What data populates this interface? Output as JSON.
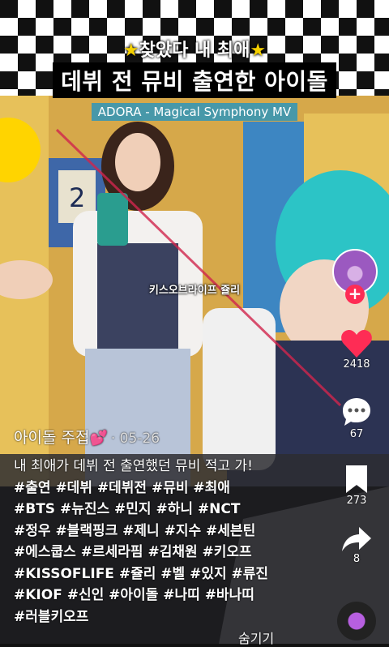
{
  "video": {
    "caption_line1": "찾았다 내 최애",
    "caption_star": "★",
    "caption_line2": "데뷔 전 뮤비 출연한 아이돌",
    "mv_label": "ADORA - Magical Symphony MV",
    "name_tag": "키스오브라이프 쥴리"
  },
  "rail": {
    "likes": "2418",
    "comments": "67",
    "bookmarks": "273",
    "shares": "8",
    "follow_symbol": "+"
  },
  "post": {
    "author": "아이돌 주접",
    "author_emoji": "💕",
    "date": "· 05-26",
    "description": "내 최애가 데뷔 전 출연했던 뮤비 적고 가!",
    "hashtags": [
      "#출연 #데뷔 #데뷔전 #뮤비 #최애",
      "#BTS #뉴진스 #민지 #하니 #NCT",
      "#정우 #블랙핑크 #제니 #지수 #세븐틴",
      "#에스쿱스 #르세라핌 #김채원 #키오프",
      "#KISSOFLIFE #쥴리 #벨 #있지 #류진",
      "#KIOF #신인 #아이돌 #나띠 #바나띠",
      "#러블키오프"
    ],
    "hide_label": "숨기기"
  },
  "colors": {
    "accent": "#fe2c55",
    "heart": "#fe2c55",
    "caption_star": "#f5d000"
  }
}
